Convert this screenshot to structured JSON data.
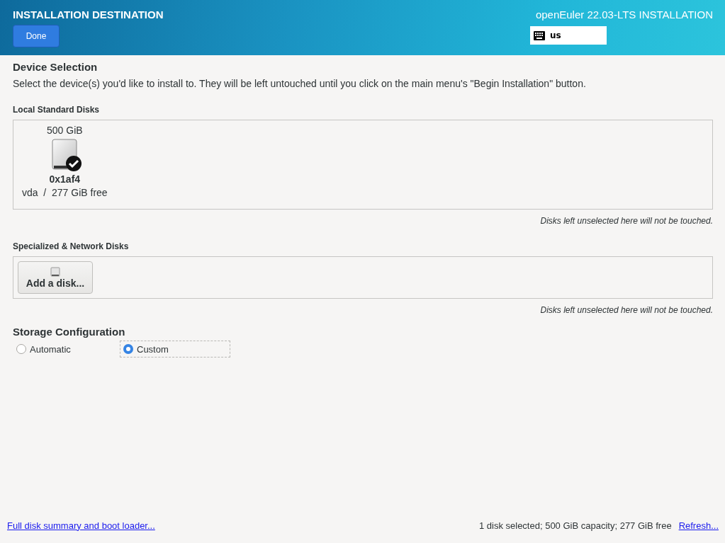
{
  "header": {
    "title": "INSTALLATION DESTINATION",
    "done_button": "Done",
    "product": "openEuler 22.03-LTS INSTALLATION",
    "keyboard_layout": "us"
  },
  "device_selection": {
    "heading": "Device Selection",
    "description": "Select the device(s) you'd like to install to.  They will be left untouched until you click on the main menu's \"Begin Installation\" button."
  },
  "local_disks": {
    "heading": "Local Standard Disks",
    "disks": [
      {
        "size": "500 GiB",
        "name": "0x1af4",
        "detail": "vda  /  277 GiB free",
        "selected": true
      }
    ],
    "note": "Disks left unselected here will not be touched."
  },
  "specialized_disks": {
    "heading": "Specialized & Network Disks",
    "add_button": "Add a disk...",
    "note": "Disks left unselected here will not be touched."
  },
  "storage_configuration": {
    "heading": "Storage Configuration",
    "options": [
      {
        "label": "Automatic",
        "selected": false
      },
      {
        "label": "Custom",
        "selected": true
      }
    ]
  },
  "footer": {
    "summary_link": "Full disk summary and boot loader...",
    "status": "1 disk selected; 500 GiB capacity; 277 GiB free",
    "refresh_link": "Refresh..."
  }
}
